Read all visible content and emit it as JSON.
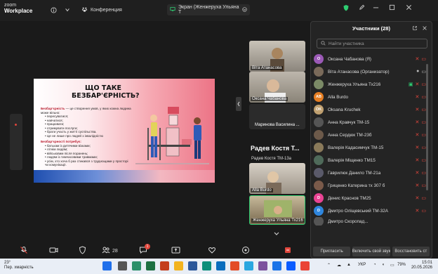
{
  "app": {
    "logo_line1": "zoom",
    "logo_line2": "Workplace"
  },
  "titlebar": {
    "conference_label": "Конференция",
    "screen_share_label": "Экран (Женжеруха Ульяна Т"
  },
  "slide": {
    "title": "ЩО ТАКЕ БЕЗБАР'ЄРНІСТЬ?",
    "definition_label": "Безбар'єрність",
    "definition_text": " — це створення умов, у яких кожна людина може вільно:",
    "bullets1": [
      "пересуватися;",
      "навчатися;",
      "працювати;",
      "отримувати послуги;",
      "брати участь у житті суспільства.",
      "Це не лише про людей з інвалідністю"
    ],
    "needs_label": "Безбар'єрності потребує:",
    "bullets2": [
      "батькам із дитячими візками;",
      "літнім людям;",
      "військовим після поранень;",
      "людям із тимчасовими травмами;",
      "усім, хто хоча б раз стикався з труднощами у просторі чи комунікації."
    ]
  },
  "thumbnails": [
    {
      "name": "Віта Атанасова"
    },
    {
      "name": "Оксана Чабанова"
    },
    {
      "name": "Маринова Василина ..."
    },
    {
      "name": "Радев Костя Т..."
    },
    {
      "name": "Радев Костя ТМ-13а"
    },
    {
      "name": "Alla Burdo"
    },
    {
      "name": "Женжеруха Ульяна Тх216"
    }
  ],
  "panel": {
    "title": "Участники (28)",
    "search_placeholder": "Найти участника",
    "participants": [
      {
        "name": "Оксана Чабанова (Я)",
        "avatar": "O",
        "color": "#9b59b6"
      },
      {
        "name": "Віта Атанасова (Организатор)",
        "avatar": "",
        "color": "#7a6a5a"
      },
      {
        "name": "Женжеруха Ульяна Тх216",
        "avatar": "",
        "color": "#7b8a66"
      },
      {
        "name": "Alla Burdo",
        "avatar": "AB",
        "color": "#e67e22"
      },
      {
        "name": "Oksana Kruchek",
        "avatar": "OK",
        "color": "#c0a070"
      },
      {
        "name": "Анна Кравчук ТМ-15",
        "avatar": "",
        "color": "#555555"
      },
      {
        "name": "Анна Сердюк ТМ-23б",
        "avatar": "",
        "color": "#6d5a4a"
      },
      {
        "name": "Валерія Кадасимчук ТМ-15",
        "avatar": "",
        "color": "#8a7a5a"
      },
      {
        "name": "Валерія Міщенко ТМ15",
        "avatar": "",
        "color": "#4f6a5a"
      },
      {
        "name": "Гаврилюк Данило ТМ-21а",
        "avatar": "",
        "color": "#5a5a6a"
      },
      {
        "name": "Гриценко Катерина тх 307 б",
        "avatar": "",
        "color": "#7a5a4a"
      },
      {
        "name": "Денис Краснов ТМ25",
        "avatar": "D",
        "color": "#e84393"
      },
      {
        "name": "Дмитро Оліщевський ТМ-32А",
        "avatar": "D",
        "color": "#2e86de"
      },
      {
        "name": "Дмитро Скоропад...",
        "avatar": "",
        "color": "#555555"
      }
    ],
    "footer": [
      "Пригласить",
      "Включить свой звук",
      "Восстановить ст"
    ]
  },
  "toolbar": {
    "participants_count": "28",
    "chat_badge": "1"
  },
  "taskbar": {
    "weather_temp": "23°",
    "weather_text": "Пер. хмарність",
    "lang": "УКР",
    "battery": "79%",
    "time": "15:01",
    "date": "20.05.2026"
  },
  "colors": {
    "zoom_blue": "#0b5cff",
    "mic_off": "#e0463c",
    "highlight_green": "#2ecc71"
  }
}
